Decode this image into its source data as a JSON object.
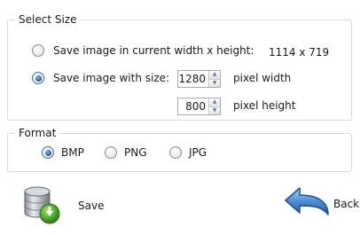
{
  "select_size": {
    "title": "Select Size",
    "option_current_label": "Save image in current width x height:",
    "current_dimensions": "1114 x 719",
    "option_custom_label": "Save image with size:",
    "width_value": "1280",
    "width_unit_label": "pixel width",
    "height_value": "800",
    "height_unit_label": "pixel height",
    "selected": "custom"
  },
  "format": {
    "title": "Format",
    "options": [
      "BMP",
      "PNG",
      "JPG"
    ],
    "selected": "BMP"
  },
  "actions": {
    "save_label": "Save",
    "back_label": "Back"
  },
  "icons": {
    "save": "database-save-icon",
    "back": "back-arrow-icon"
  }
}
